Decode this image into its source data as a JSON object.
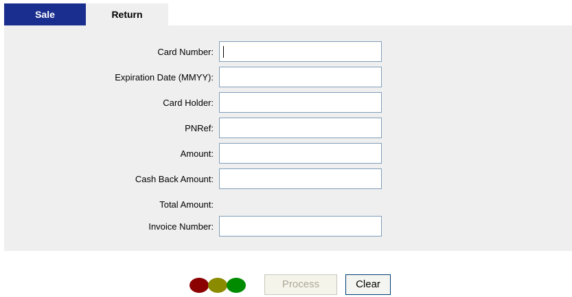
{
  "tabs": [
    {
      "label": "Sale",
      "active": true
    },
    {
      "label": "Return",
      "active": false
    }
  ],
  "form": {
    "card_number": {
      "label": "Card Number:",
      "value": ""
    },
    "expiration": {
      "label": "Expiration Date (MMYY):",
      "value": ""
    },
    "card_holder": {
      "label": "Card Holder:",
      "value": ""
    },
    "pnref": {
      "label": "PNRef:",
      "value": ""
    },
    "amount": {
      "label": "Amount:",
      "value": ""
    },
    "cash_back": {
      "label": "Cash Back Amount:",
      "value": ""
    },
    "total_amount": {
      "label": "Total Amount:",
      "value": ""
    },
    "invoice_number": {
      "label": "Invoice Number:",
      "value": ""
    }
  },
  "status_lights": {
    "colors": [
      "#8b0000",
      "#8b8b00",
      "#008b00"
    ],
    "icon": "traffic-light-icon"
  },
  "buttons": {
    "process_label": "Process",
    "process_enabled": false,
    "clear_label": "Clear"
  },
  "colors": {
    "tab_active_bg": "#1a2e8f",
    "panel_bg": "#efefef",
    "field_border": "#7f9db9"
  }
}
